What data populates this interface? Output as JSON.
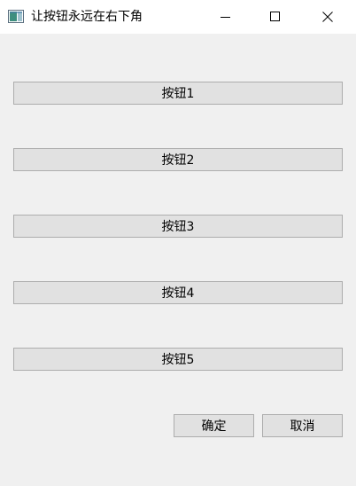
{
  "window": {
    "title": "让按钮永远在右下角"
  },
  "buttons": [
    {
      "label": "按钮1"
    },
    {
      "label": "按钮2"
    },
    {
      "label": "按钮3"
    },
    {
      "label": "按钮4"
    },
    {
      "label": "按钮5"
    }
  ],
  "footer": {
    "ok_label": "确定",
    "cancel_label": "取消"
  },
  "icons": {
    "app": "window-app-icon",
    "minimize": "minimize-icon",
    "maximize": "maximize-icon",
    "close": "close-icon"
  }
}
